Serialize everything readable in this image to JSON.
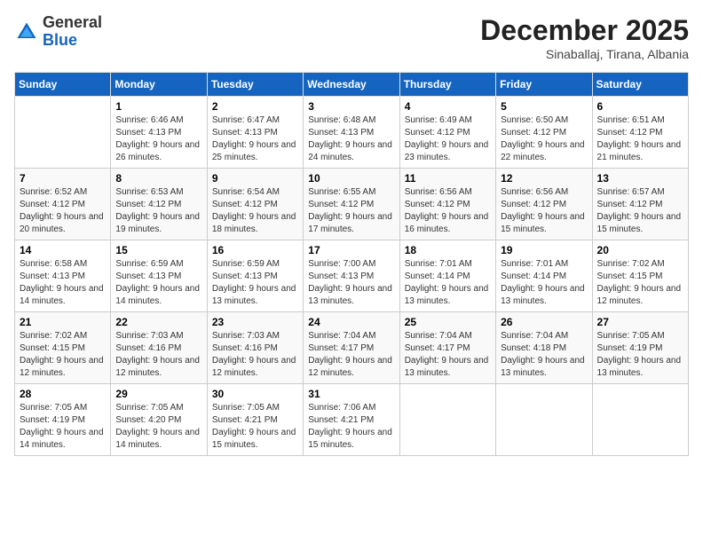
{
  "header": {
    "logo": {
      "general": "General",
      "blue": "Blue"
    },
    "month": "December 2025",
    "location": "Sinaballaj, Tirana, Albania"
  },
  "calendar": {
    "days_of_week": [
      "Sunday",
      "Monday",
      "Tuesday",
      "Wednesday",
      "Thursday",
      "Friday",
      "Saturday"
    ],
    "weeks": [
      [
        {
          "day": "",
          "sunrise": "",
          "sunset": "",
          "daylight": ""
        },
        {
          "day": "1",
          "sunrise": "Sunrise: 6:46 AM",
          "sunset": "Sunset: 4:13 PM",
          "daylight": "Daylight: 9 hours and 26 minutes."
        },
        {
          "day": "2",
          "sunrise": "Sunrise: 6:47 AM",
          "sunset": "Sunset: 4:13 PM",
          "daylight": "Daylight: 9 hours and 25 minutes."
        },
        {
          "day": "3",
          "sunrise": "Sunrise: 6:48 AM",
          "sunset": "Sunset: 4:13 PM",
          "daylight": "Daylight: 9 hours and 24 minutes."
        },
        {
          "day": "4",
          "sunrise": "Sunrise: 6:49 AM",
          "sunset": "Sunset: 4:12 PM",
          "daylight": "Daylight: 9 hours and 23 minutes."
        },
        {
          "day": "5",
          "sunrise": "Sunrise: 6:50 AM",
          "sunset": "Sunset: 4:12 PM",
          "daylight": "Daylight: 9 hours and 22 minutes."
        },
        {
          "day": "6",
          "sunrise": "Sunrise: 6:51 AM",
          "sunset": "Sunset: 4:12 PM",
          "daylight": "Daylight: 9 hours and 21 minutes."
        }
      ],
      [
        {
          "day": "7",
          "sunrise": "Sunrise: 6:52 AM",
          "sunset": "Sunset: 4:12 PM",
          "daylight": "Daylight: 9 hours and 20 minutes."
        },
        {
          "day": "8",
          "sunrise": "Sunrise: 6:53 AM",
          "sunset": "Sunset: 4:12 PM",
          "daylight": "Daylight: 9 hours and 19 minutes."
        },
        {
          "day": "9",
          "sunrise": "Sunrise: 6:54 AM",
          "sunset": "Sunset: 4:12 PM",
          "daylight": "Daylight: 9 hours and 18 minutes."
        },
        {
          "day": "10",
          "sunrise": "Sunrise: 6:55 AM",
          "sunset": "Sunset: 4:12 PM",
          "daylight": "Daylight: 9 hours and 17 minutes."
        },
        {
          "day": "11",
          "sunrise": "Sunrise: 6:56 AM",
          "sunset": "Sunset: 4:12 PM",
          "daylight": "Daylight: 9 hours and 16 minutes."
        },
        {
          "day": "12",
          "sunrise": "Sunrise: 6:56 AM",
          "sunset": "Sunset: 4:12 PM",
          "daylight": "Daylight: 9 hours and 15 minutes."
        },
        {
          "day": "13",
          "sunrise": "Sunrise: 6:57 AM",
          "sunset": "Sunset: 4:12 PM",
          "daylight": "Daylight: 9 hours and 15 minutes."
        }
      ],
      [
        {
          "day": "14",
          "sunrise": "Sunrise: 6:58 AM",
          "sunset": "Sunset: 4:13 PM",
          "daylight": "Daylight: 9 hours and 14 minutes."
        },
        {
          "day": "15",
          "sunrise": "Sunrise: 6:59 AM",
          "sunset": "Sunset: 4:13 PM",
          "daylight": "Daylight: 9 hours and 14 minutes."
        },
        {
          "day": "16",
          "sunrise": "Sunrise: 6:59 AM",
          "sunset": "Sunset: 4:13 PM",
          "daylight": "Daylight: 9 hours and 13 minutes."
        },
        {
          "day": "17",
          "sunrise": "Sunrise: 7:00 AM",
          "sunset": "Sunset: 4:13 PM",
          "daylight": "Daylight: 9 hours and 13 minutes."
        },
        {
          "day": "18",
          "sunrise": "Sunrise: 7:01 AM",
          "sunset": "Sunset: 4:14 PM",
          "daylight": "Daylight: 9 hours and 13 minutes."
        },
        {
          "day": "19",
          "sunrise": "Sunrise: 7:01 AM",
          "sunset": "Sunset: 4:14 PM",
          "daylight": "Daylight: 9 hours and 13 minutes."
        },
        {
          "day": "20",
          "sunrise": "Sunrise: 7:02 AM",
          "sunset": "Sunset: 4:15 PM",
          "daylight": "Daylight: 9 hours and 12 minutes."
        }
      ],
      [
        {
          "day": "21",
          "sunrise": "Sunrise: 7:02 AM",
          "sunset": "Sunset: 4:15 PM",
          "daylight": "Daylight: 9 hours and 12 minutes."
        },
        {
          "day": "22",
          "sunrise": "Sunrise: 7:03 AM",
          "sunset": "Sunset: 4:16 PM",
          "daylight": "Daylight: 9 hours and 12 minutes."
        },
        {
          "day": "23",
          "sunrise": "Sunrise: 7:03 AM",
          "sunset": "Sunset: 4:16 PM",
          "daylight": "Daylight: 9 hours and 12 minutes."
        },
        {
          "day": "24",
          "sunrise": "Sunrise: 7:04 AM",
          "sunset": "Sunset: 4:17 PM",
          "daylight": "Daylight: 9 hours and 12 minutes."
        },
        {
          "day": "25",
          "sunrise": "Sunrise: 7:04 AM",
          "sunset": "Sunset: 4:17 PM",
          "daylight": "Daylight: 9 hours and 13 minutes."
        },
        {
          "day": "26",
          "sunrise": "Sunrise: 7:04 AM",
          "sunset": "Sunset: 4:18 PM",
          "daylight": "Daylight: 9 hours and 13 minutes."
        },
        {
          "day": "27",
          "sunrise": "Sunrise: 7:05 AM",
          "sunset": "Sunset: 4:19 PM",
          "daylight": "Daylight: 9 hours and 13 minutes."
        }
      ],
      [
        {
          "day": "28",
          "sunrise": "Sunrise: 7:05 AM",
          "sunset": "Sunset: 4:19 PM",
          "daylight": "Daylight: 9 hours and 14 minutes."
        },
        {
          "day": "29",
          "sunrise": "Sunrise: 7:05 AM",
          "sunset": "Sunset: 4:20 PM",
          "daylight": "Daylight: 9 hours and 14 minutes."
        },
        {
          "day": "30",
          "sunrise": "Sunrise: 7:05 AM",
          "sunset": "Sunset: 4:21 PM",
          "daylight": "Daylight: 9 hours and 15 minutes."
        },
        {
          "day": "31",
          "sunrise": "Sunrise: 7:06 AM",
          "sunset": "Sunset: 4:21 PM",
          "daylight": "Daylight: 9 hours and 15 minutes."
        },
        {
          "day": "",
          "sunrise": "",
          "sunset": "",
          "daylight": ""
        },
        {
          "day": "",
          "sunrise": "",
          "sunset": "",
          "daylight": ""
        },
        {
          "day": "",
          "sunrise": "",
          "sunset": "",
          "daylight": ""
        }
      ]
    ]
  }
}
